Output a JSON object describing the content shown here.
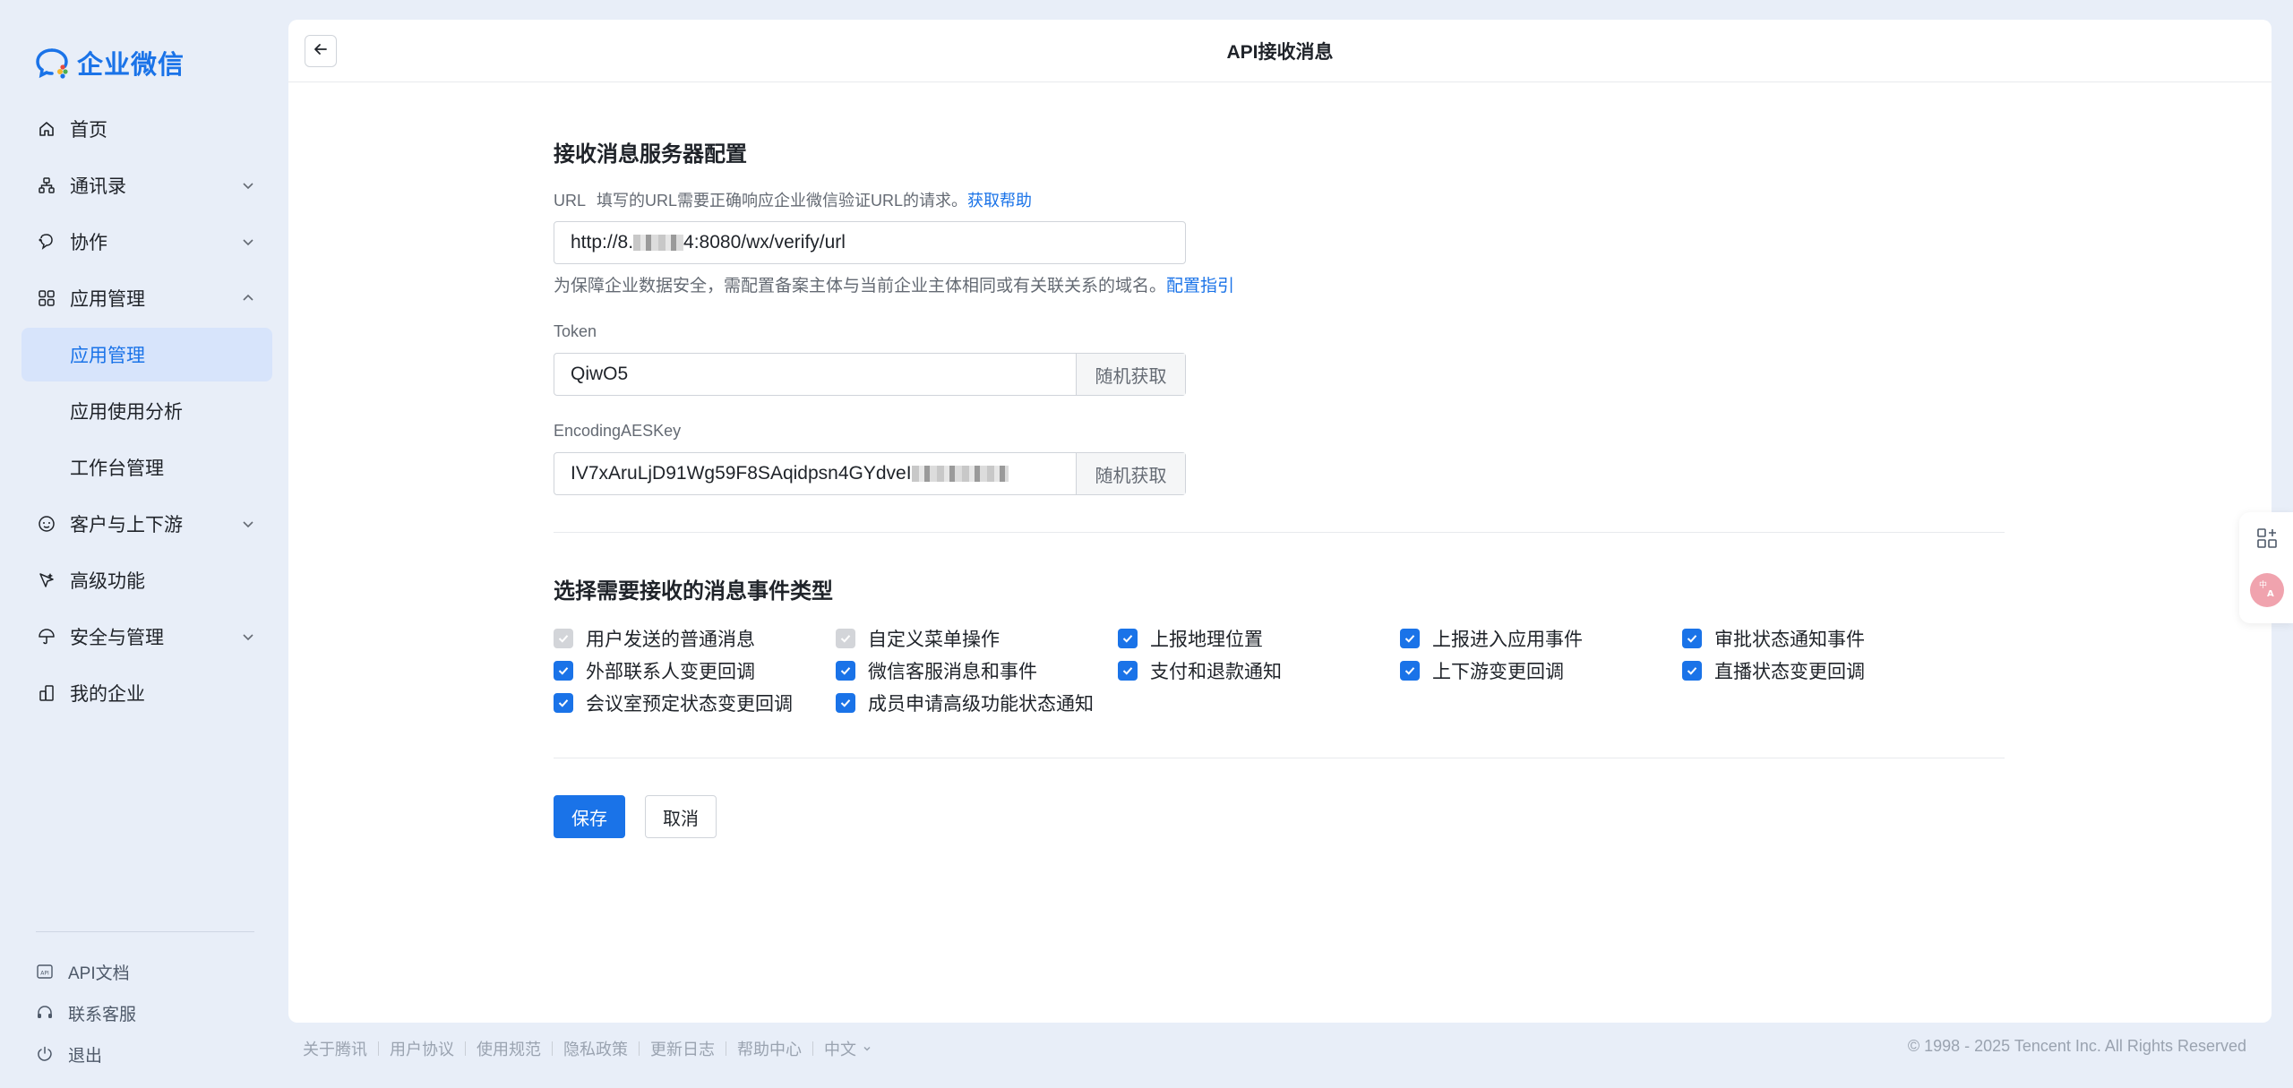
{
  "brand": {
    "name": "企业微信",
    "color": "#1a73e8"
  },
  "sidebar": {
    "items": [
      {
        "label": "首页",
        "icon": "home-icon"
      },
      {
        "label": "通讯录",
        "icon": "org-chart-icon",
        "expandable": true
      },
      {
        "label": "协作",
        "icon": "collab-icon",
        "expandable": true
      },
      {
        "label": "应用管理",
        "icon": "apps-grid-icon",
        "expanded": true
      },
      {
        "label": "应用管理",
        "sub": true,
        "active": true
      },
      {
        "label": "应用使用分析",
        "sub": true
      },
      {
        "label": "工作台管理",
        "sub": true
      },
      {
        "label": "客户与上下游",
        "icon": "customer-icon",
        "expandable": true
      },
      {
        "label": "高级功能",
        "icon": "advanced-icon"
      },
      {
        "label": "安全与管理",
        "icon": "umbrella-icon",
        "expandable": true
      },
      {
        "label": "我的企业",
        "icon": "building-icon"
      }
    ],
    "bottom": [
      {
        "label": "API文档",
        "icon": "api-doc-icon"
      },
      {
        "label": "联系客服",
        "icon": "headset-icon"
      },
      {
        "label": "退出",
        "icon": "power-icon"
      }
    ]
  },
  "header": {
    "title": "API接收消息"
  },
  "server_config": {
    "title": "接收消息服务器配置",
    "url": {
      "label": "URL",
      "hint": "填写的URL需要正确响应企业微信验证URL的请求。",
      "help_link": "获取帮助",
      "value_prefix": "http://8.",
      "value_suffix": "4:8080/wx/verify/url",
      "note": "为保障企业数据安全，需配置备案主体与当前企业主体相同或有关联关系的域名。",
      "note_link": "配置指引"
    },
    "token": {
      "label": "Token",
      "value": "QiwO5",
      "random_button": "随机获取"
    },
    "aes_key": {
      "label": "EncodingAESKey",
      "value": "IV7xAruLjD91Wg59F8SAqidpsn4GYdveI",
      "random_button": "随机获取"
    }
  },
  "events_section": {
    "title": "选择需要接收的消息事件类型",
    "events": [
      {
        "label": "用户发送的普通消息",
        "checked": true,
        "disabled": true
      },
      {
        "label": "自定义菜单操作",
        "checked": true,
        "disabled": true
      },
      {
        "label": "上报地理位置",
        "checked": true
      },
      {
        "label": "上报进入应用事件",
        "checked": true
      },
      {
        "label": "审批状态通知事件",
        "checked": true
      },
      {
        "label": "外部联系人变更回调",
        "checked": true
      },
      {
        "label": "微信客服消息和事件",
        "checked": true
      },
      {
        "label": "支付和退款通知",
        "checked": true
      },
      {
        "label": "上下游变更回调",
        "checked": true
      },
      {
        "label": "直播状态变更回调",
        "checked": true
      },
      {
        "label": "会议室预定状态变更回调",
        "checked": true
      },
      {
        "label": "成员申请高级功能状态通知",
        "checked": true
      }
    ]
  },
  "actions": {
    "save": "保存",
    "cancel": "取消"
  },
  "footer": {
    "links": [
      "关于腾讯",
      "用户协议",
      "使用规范",
      "隐私政策",
      "更新日志",
      "帮助中心",
      "中文"
    ],
    "copyright": "© 1998 - 2025 Tencent Inc. All Rights Reserved"
  },
  "colors": {
    "accent": "#1a73e8",
    "active_bg": "#d7e4fb",
    "page_bg": "#e8eef8"
  }
}
